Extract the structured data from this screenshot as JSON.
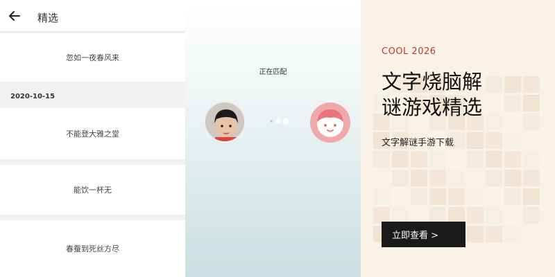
{
  "panel1": {
    "title": "精选",
    "items": [
      {
        "text": "忽如一夜春风来"
      },
      {
        "text": "不能登大雅之堂"
      },
      {
        "text": "能饮一杯无"
      },
      {
        "text": "春蚕到死丝方尽"
      }
    ],
    "date": "2020-10-15"
  },
  "panel2": {
    "status": "正在匹配"
  },
  "panel3": {
    "brand": "COOL 2026",
    "headline_line1": "文字烧脑解",
    "headline_line2": "谜游戏精选",
    "subtitle": "文字解谜手游下载",
    "cta_label": "立即查看 >"
  },
  "colors": {
    "accent_red": "#c0392b",
    "cta_bg": "#1a1a1a",
    "opponent_pink": "#f1a8aa"
  }
}
